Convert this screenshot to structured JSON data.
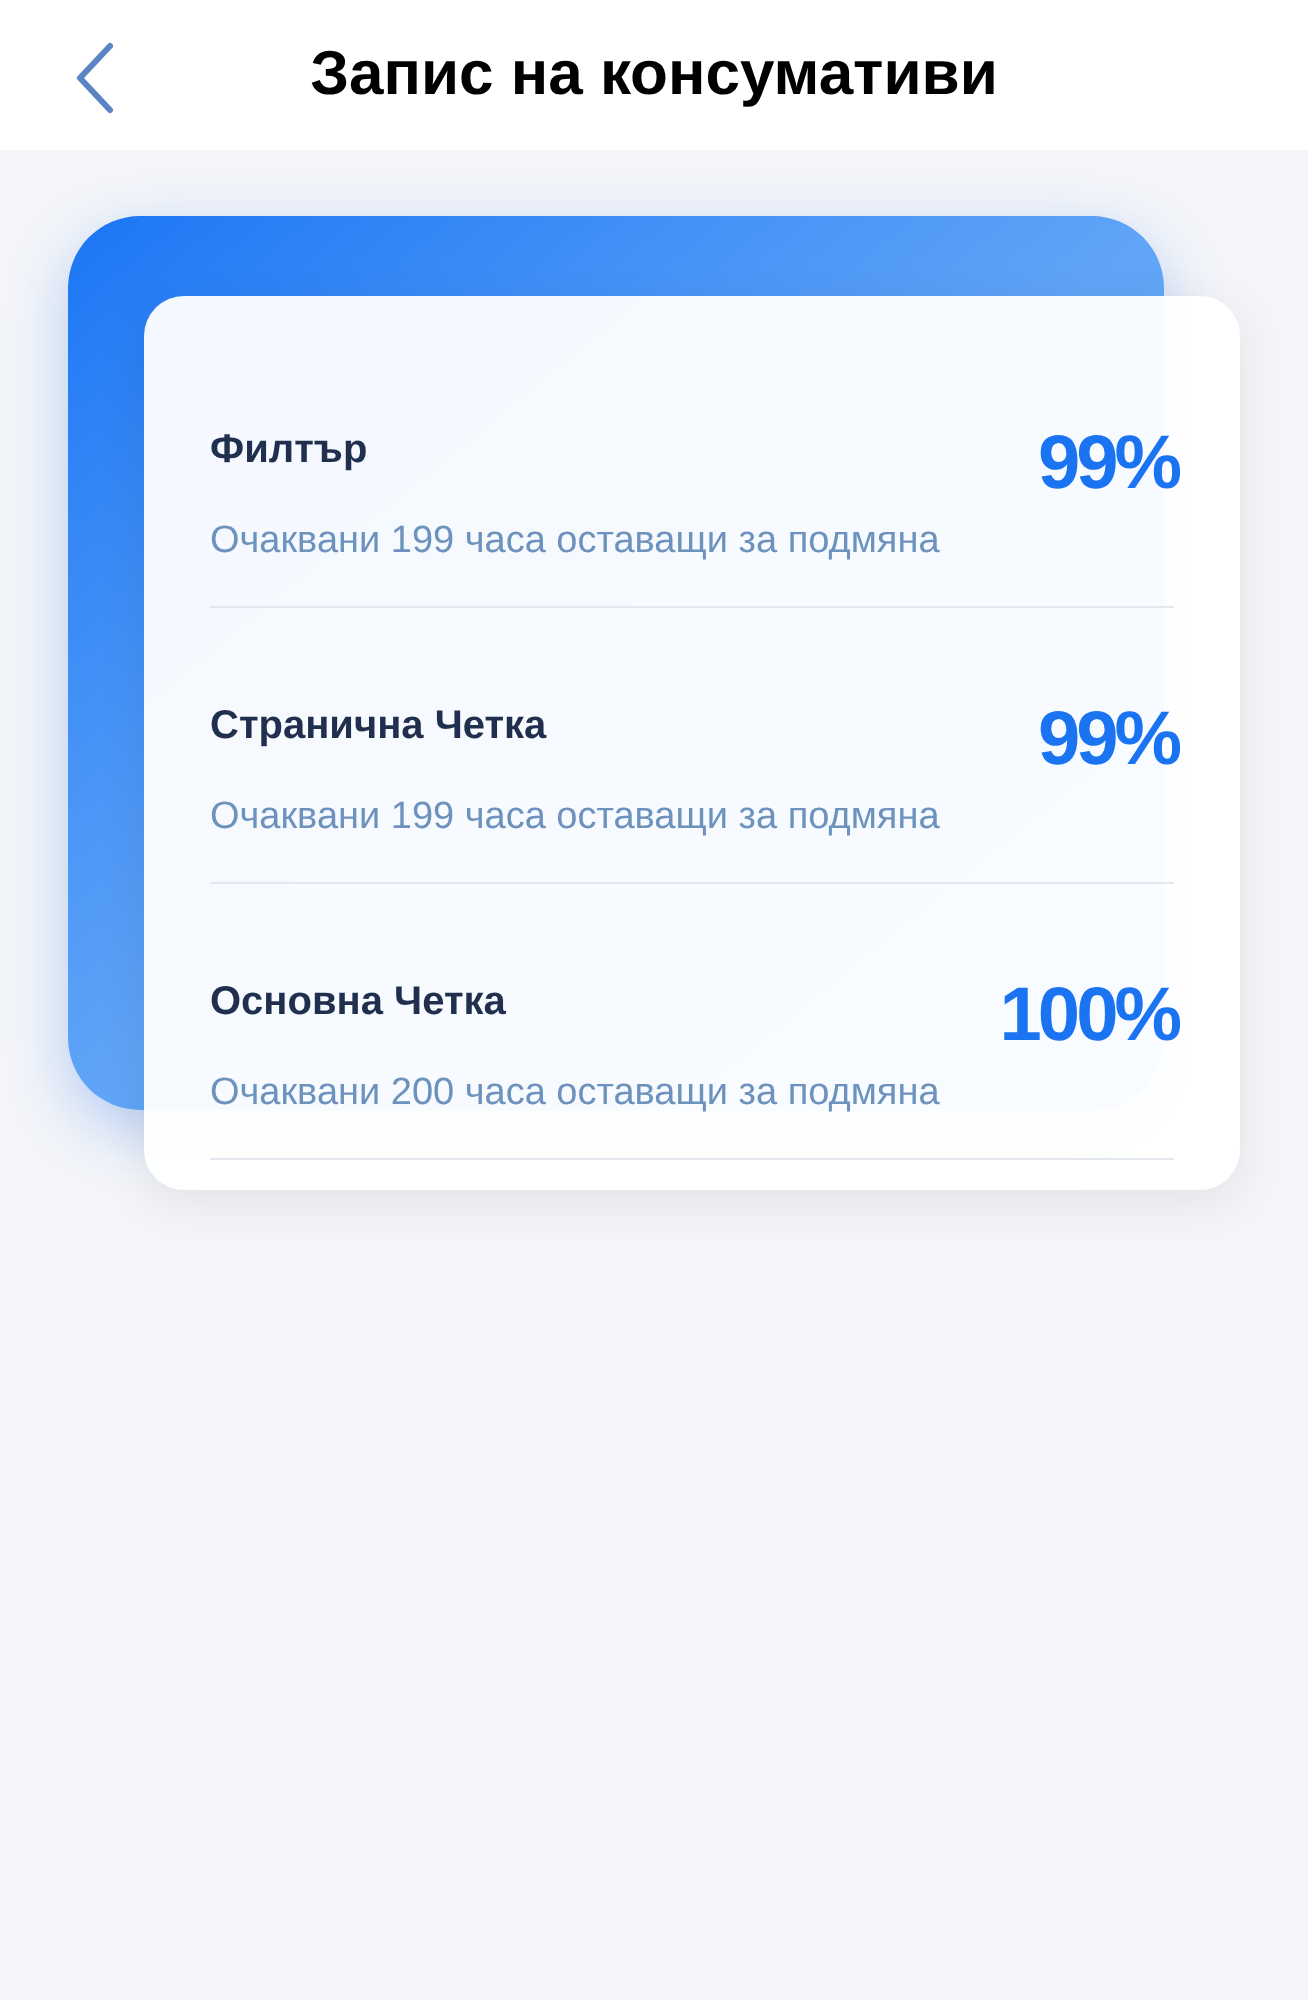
{
  "header": {
    "title": "Запис на консумативи"
  },
  "consumables": [
    {
      "name": "Филтър",
      "percent": "99%",
      "note": "Очаквани 199 часа оставащи за подмяна"
    },
    {
      "name": "Странична Четка",
      "percent": "99%",
      "note": "Очаквани 199 часа оставащи за подмяна"
    },
    {
      "name": "Основна Четка",
      "percent": "100%",
      "note": "Очаквани 200 часа оставащи за подмяна"
    }
  ]
}
